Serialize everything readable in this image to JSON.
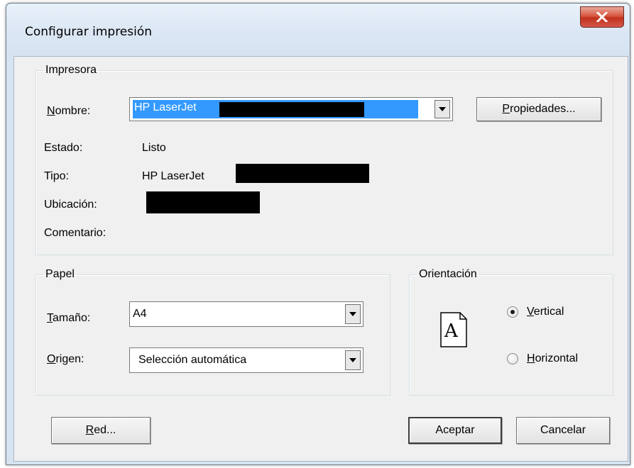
{
  "window": {
    "title": "Configurar impresión",
    "close_icon": "close-icon"
  },
  "printer_group": {
    "legend": "Impresora",
    "name_label_first": "N",
    "name_label_rest": "ombre:",
    "printer_name_value": "HP LaserJet",
    "properties_first": "P",
    "properties_rest": "ropiedades...",
    "status_label": "Estado:",
    "status_value": "Listo",
    "type_label": "Tipo:",
    "type_value": "HP LaserJet",
    "location_label": "Ubicación:",
    "comment_label": "Comentario:"
  },
  "paper_group": {
    "legend": "Papel",
    "size_label_first": "T",
    "size_label_rest": "amaño:",
    "size_value": "A4",
    "source_label_first": "O",
    "source_label_rest": "rigen:",
    "source_value": "Selección automática"
  },
  "orientation_group": {
    "legend": "Orientación",
    "page_glyph": "A",
    "vertical_first": "V",
    "vertical_rest": "ertical",
    "horizontal_first": "H",
    "horizontal_rest": "orizontal",
    "selected": "vertical"
  },
  "buttons": {
    "network_first": "R",
    "network_rest": "ed...",
    "ok": "Aceptar",
    "cancel": "Cancelar"
  },
  "colors": {
    "selection": "#3399ff",
    "close_button": "#c7412c"
  }
}
